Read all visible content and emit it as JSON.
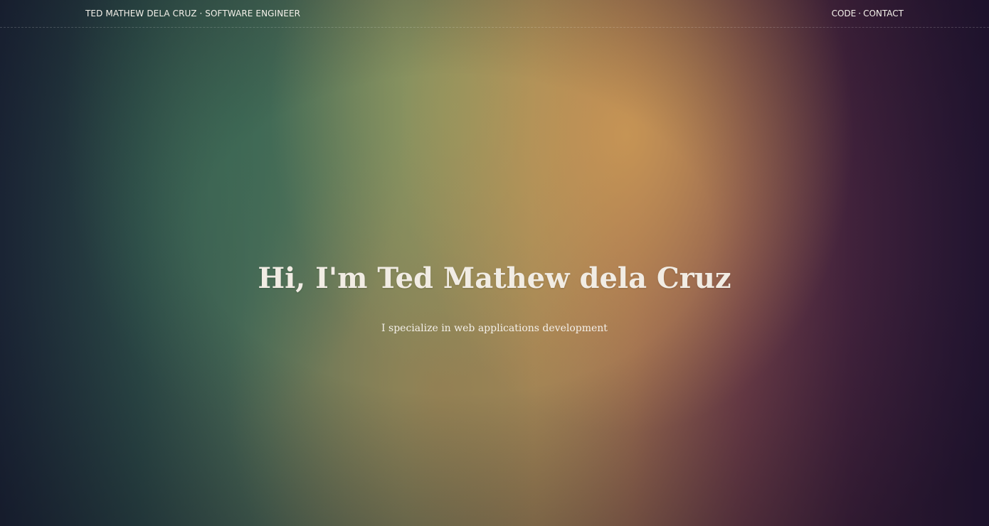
{
  "header": {
    "brand": "TED MATHEW DELA CRUZ · SOFTWARE ENGINEER",
    "nav": [
      {
        "label": "CODE"
      },
      {
        "label": "CONTACT"
      }
    ],
    "nav_separator": "·"
  },
  "hero": {
    "title": "Hi, I'm Ted Mathew dela Cruz",
    "subtitle": "I specialize in web applications development"
  },
  "colors": {
    "text": "#f3efe9",
    "bg_left": "#1f2c3c",
    "bg_center": "#c89655",
    "bg_right": "#2c1a3a"
  }
}
